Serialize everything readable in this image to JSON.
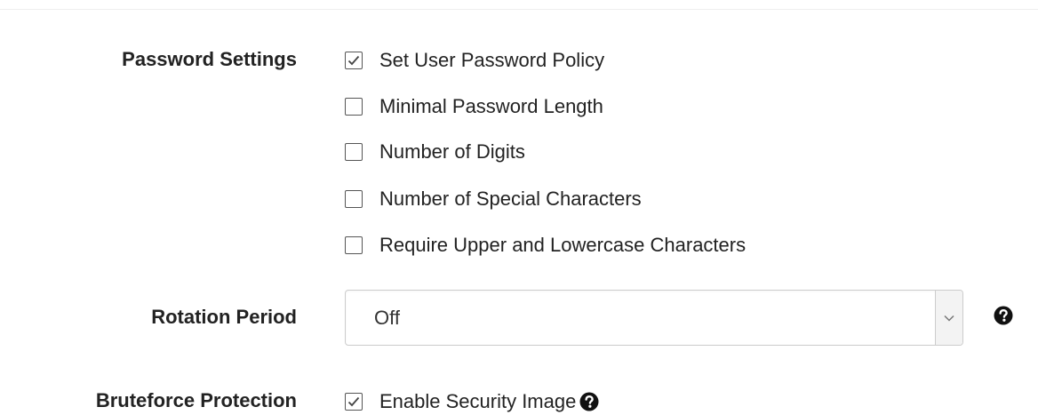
{
  "password_settings": {
    "label": "Password Settings",
    "options": [
      {
        "label": "Set User Password Policy",
        "checked": true
      },
      {
        "label": "Minimal Password Length",
        "checked": false
      },
      {
        "label": "Number of Digits",
        "checked": false
      },
      {
        "label": "Number of Special Characters",
        "checked": false
      },
      {
        "label": "Require Upper and Lowercase Characters",
        "checked": false
      }
    ]
  },
  "rotation_period": {
    "label": "Rotation Period",
    "selected": "Off",
    "help_icon": "question-circle-icon"
  },
  "bruteforce_protection": {
    "label": "Bruteforce Protection",
    "option": {
      "label": "Enable Security Image",
      "checked": true
    },
    "help_icon": "question-circle-icon"
  }
}
